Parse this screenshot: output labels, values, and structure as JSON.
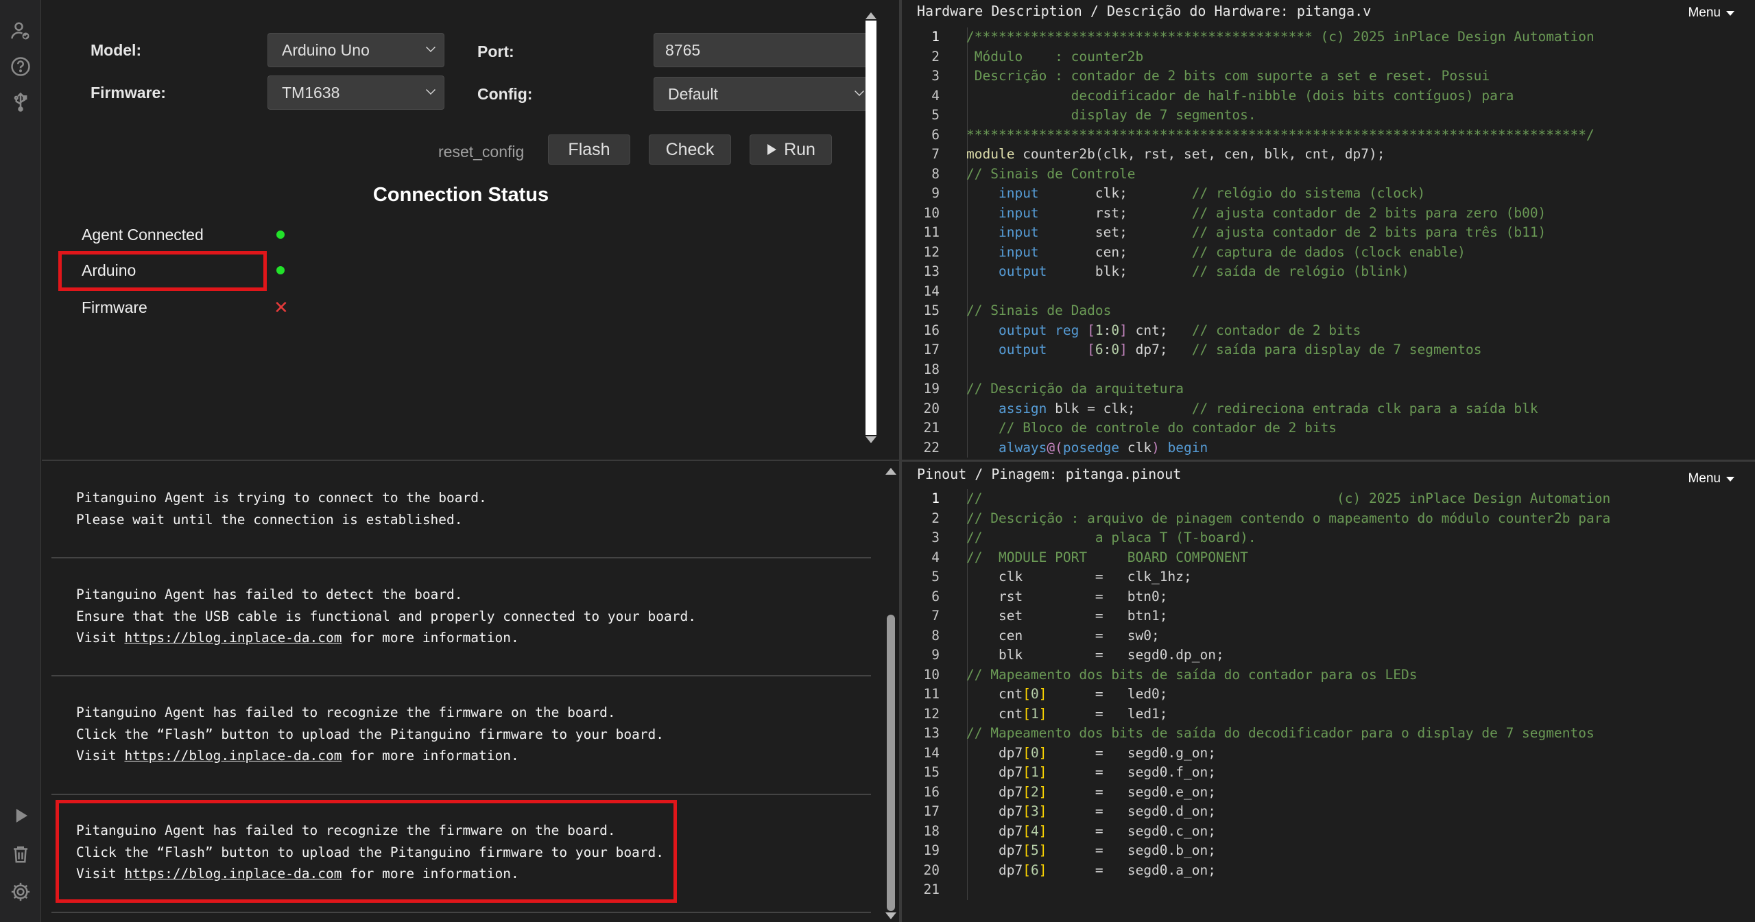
{
  "rail": {
    "icons": [
      "user-check-icon",
      "help-icon",
      "usb-icon",
      "play-icon",
      "trash-icon",
      "gear-icon"
    ]
  },
  "config": {
    "model_label": "Model:",
    "model_value": "Arduino Uno",
    "port_label": "Port:",
    "port_value": "8765",
    "firmware_label": "Firmware:",
    "firmware_value": "TM1638",
    "config_label": "Config:",
    "config_value": "Default",
    "reset_config": "reset_config",
    "flash_label": "Flash",
    "check_label": "Check",
    "run_label": "Run"
  },
  "connection": {
    "title": "Connection Status",
    "agent_label": "Agent Connected",
    "agent_status": "connected",
    "arduino_label": "Arduino",
    "arduino_status": "connected",
    "firmware_label": "Firmware",
    "firmware_status": "failed",
    "firmware_mark": "✕",
    "status_colors": {
      "ok": "#22e22a",
      "fail": "#e53a3a"
    }
  },
  "console": {
    "messages": [
      {
        "lines": [
          "Pitanguino Agent is trying to connect to the board.",
          "Please wait until the connection is established."
        ]
      },
      {
        "lines": [
          "Pitanguino Agent has failed to detect the board.",
          "Ensure that the USB cable is functional and properly connected to your board."
        ],
        "visit_pre": "Visit ",
        "link": "https://blog.inplace-da.com",
        "visit_post": " for more information."
      },
      {
        "lines": [
          "Pitanguino Agent has failed to recognize the firmware on the board.",
          "Click the “Flash” button to upload the Pitanguino firmware to your board."
        ],
        "visit_pre": "Visit ",
        "link": "https://blog.inplace-da.com",
        "visit_post": " for more information."
      },
      {
        "lines": [
          "Pitanguino Agent has failed to recognize the firmware on the board.",
          "Click the “Flash” button to upload the Pitanguino firmware to your board."
        ],
        "visit_pre": "Visit ",
        "link": "https://blog.inplace-da.com",
        "visit_post": " for more information."
      }
    ]
  },
  "hardware": {
    "title": "Hardware Description / Descrição do Hardware: pitanga.v",
    "menu_label": "Menu",
    "lines": [
      [
        [
          "c",
          "/****************************************** (c) 2025 inPlace Design Automation"
        ]
      ],
      [
        [
          "c",
          " Módulo    : counter2b"
        ]
      ],
      [
        [
          "c",
          " Descrição : contador de 2 bits com suporte a set e reset. Possui"
        ]
      ],
      [
        [
          "c",
          "             decodificador de half-nibble (dois bits contíguos) para"
        ]
      ],
      [
        [
          "c",
          "             display de 7 segmentos."
        ]
      ],
      [
        [
          "c",
          "*****************************************************************************/"
        ]
      ],
      [
        [
          "kw",
          "module"
        ],
        [
          "id",
          " counter2b(clk, rst, set, cen, blk, cnt, dp7);"
        ]
      ],
      [
        [
          "c",
          "// Sinais de Controle"
        ]
      ],
      [
        [
          "id",
          "    "
        ],
        [
          "k",
          "input"
        ],
        [
          "id",
          "       clk;        "
        ],
        [
          "c",
          "// relógio do sistema (clock)"
        ]
      ],
      [
        [
          "id",
          "    "
        ],
        [
          "k",
          "input"
        ],
        [
          "id",
          "       rst;        "
        ],
        [
          "c",
          "// ajusta contador de 2 bits para zero (b00)"
        ]
      ],
      [
        [
          "id",
          "    "
        ],
        [
          "k",
          "input"
        ],
        [
          "id",
          "       set;        "
        ],
        [
          "c",
          "// ajusta contador de 2 bits para três (b11)"
        ]
      ],
      [
        [
          "id",
          "    "
        ],
        [
          "k",
          "input"
        ],
        [
          "id",
          "       cen;        "
        ],
        [
          "c",
          "// captura de dados (clock enable)"
        ]
      ],
      [
        [
          "id",
          "    "
        ],
        [
          "k",
          "output"
        ],
        [
          "id",
          "      blk;        "
        ],
        [
          "c",
          "// saída de relógio (blink)"
        ]
      ],
      [
        [
          "id",
          ""
        ]
      ],
      [
        [
          "c",
          "// Sinais de Dados"
        ]
      ],
      [
        [
          "id",
          "    "
        ],
        [
          "k",
          "output"
        ],
        [
          "id",
          " "
        ],
        [
          "k",
          "reg"
        ],
        [
          "id",
          " "
        ],
        [
          "pu",
          "["
        ],
        [
          "n",
          "1"
        ],
        [
          "id",
          ":"
        ],
        [
          "n",
          "0"
        ],
        [
          "pu",
          "]"
        ],
        [
          "id",
          " cnt;   "
        ],
        [
          "c",
          "// contador de 2 bits"
        ]
      ],
      [
        [
          "id",
          "    "
        ],
        [
          "k",
          "output"
        ],
        [
          "id",
          "     "
        ],
        [
          "pu",
          "["
        ],
        [
          "n",
          "6"
        ],
        [
          "id",
          ":"
        ],
        [
          "n",
          "0"
        ],
        [
          "pu",
          "]"
        ],
        [
          "id",
          " dp7;   "
        ],
        [
          "c",
          "// saída para display de 7 segmentos"
        ]
      ],
      [
        [
          "id",
          ""
        ]
      ],
      [
        [
          "c",
          "// Descrição da arquitetura"
        ]
      ],
      [
        [
          "id",
          "    "
        ],
        [
          "k",
          "assign"
        ],
        [
          "id",
          " blk = clk;       "
        ],
        [
          "c",
          "// redireciona entrada clk para a saída blk"
        ]
      ],
      [
        [
          "id",
          "    "
        ],
        [
          "c",
          "// Bloco de controle do contador de 2 bits"
        ]
      ],
      [
        [
          "id",
          "    "
        ],
        [
          "k",
          "always"
        ],
        [
          "pu",
          "@("
        ],
        [
          "k",
          "posedge"
        ],
        [
          "id",
          " clk"
        ],
        [
          "pu",
          ")"
        ],
        [
          "id",
          " "
        ],
        [
          "k",
          "begin"
        ]
      ]
    ]
  },
  "pinout": {
    "title": "Pinout / Pinagem: pitanga.pinout",
    "menu_label": "Menu",
    "lines": [
      [
        [
          "c",
          "//                                            (c) 2025 inPlace Design Automation"
        ]
      ],
      [
        [
          "c",
          "// Descrição : arquivo de pinagem contendo o mapeamento do módulo counter2b para"
        ]
      ],
      [
        [
          "c",
          "//              a placa T (T-board)."
        ]
      ],
      [
        [
          "c",
          "//  MODULE PORT     BOARD COMPONENT"
        ]
      ],
      [
        [
          "id",
          "    clk         =   clk_1hz;"
        ]
      ],
      [
        [
          "id",
          "    rst         =   btn0;"
        ]
      ],
      [
        [
          "id",
          "    set         =   btn1;"
        ]
      ],
      [
        [
          "id",
          "    cen         =   sw0;"
        ]
      ],
      [
        [
          "id",
          "    blk         =   segd0.dp_on;"
        ]
      ],
      [
        [
          "c",
          "// Mapeamento dos bits de saída do contador para os LEDs"
        ]
      ],
      [
        [
          "id",
          "    cnt"
        ],
        [
          "br",
          "["
        ],
        [
          "n",
          "0"
        ],
        [
          "br",
          "]"
        ],
        [
          "id",
          "      =   led0;"
        ]
      ],
      [
        [
          "id",
          "    cnt"
        ],
        [
          "br",
          "["
        ],
        [
          "n",
          "1"
        ],
        [
          "br",
          "]"
        ],
        [
          "id",
          "      =   led1;"
        ]
      ],
      [
        [
          "c",
          "// Mapeamento dos bits de saída do decodificador para o display de 7 segmentos"
        ]
      ],
      [
        [
          "id",
          "    dp7"
        ],
        [
          "br",
          "["
        ],
        [
          "n",
          "0"
        ],
        [
          "br",
          "]"
        ],
        [
          "id",
          "      =   segd0.g_on;"
        ]
      ],
      [
        [
          "id",
          "    dp7"
        ],
        [
          "br",
          "["
        ],
        [
          "n",
          "1"
        ],
        [
          "br",
          "]"
        ],
        [
          "id",
          "      =   segd0.f_on;"
        ]
      ],
      [
        [
          "id",
          "    dp7"
        ],
        [
          "br",
          "["
        ],
        [
          "n",
          "2"
        ],
        [
          "br",
          "]"
        ],
        [
          "id",
          "      =   segd0.e_on;"
        ]
      ],
      [
        [
          "id",
          "    dp7"
        ],
        [
          "br",
          "["
        ],
        [
          "n",
          "3"
        ],
        [
          "br",
          "]"
        ],
        [
          "id",
          "      =   segd0.d_on;"
        ]
      ],
      [
        [
          "id",
          "    dp7"
        ],
        [
          "br",
          "["
        ],
        [
          "n",
          "4"
        ],
        [
          "br",
          "]"
        ],
        [
          "id",
          "      =   segd0.c_on;"
        ]
      ],
      [
        [
          "id",
          "    dp7"
        ],
        [
          "br",
          "["
        ],
        [
          "n",
          "5"
        ],
        [
          "br",
          "]"
        ],
        [
          "id",
          "      =   segd0.b_on;"
        ]
      ],
      [
        [
          "id",
          "    dp7"
        ],
        [
          "br",
          "["
        ],
        [
          "n",
          "6"
        ],
        [
          "br",
          "]"
        ],
        [
          "id",
          "      =   segd0.a_on;"
        ]
      ],
      [
        [
          "id",
          ""
        ]
      ]
    ]
  }
}
